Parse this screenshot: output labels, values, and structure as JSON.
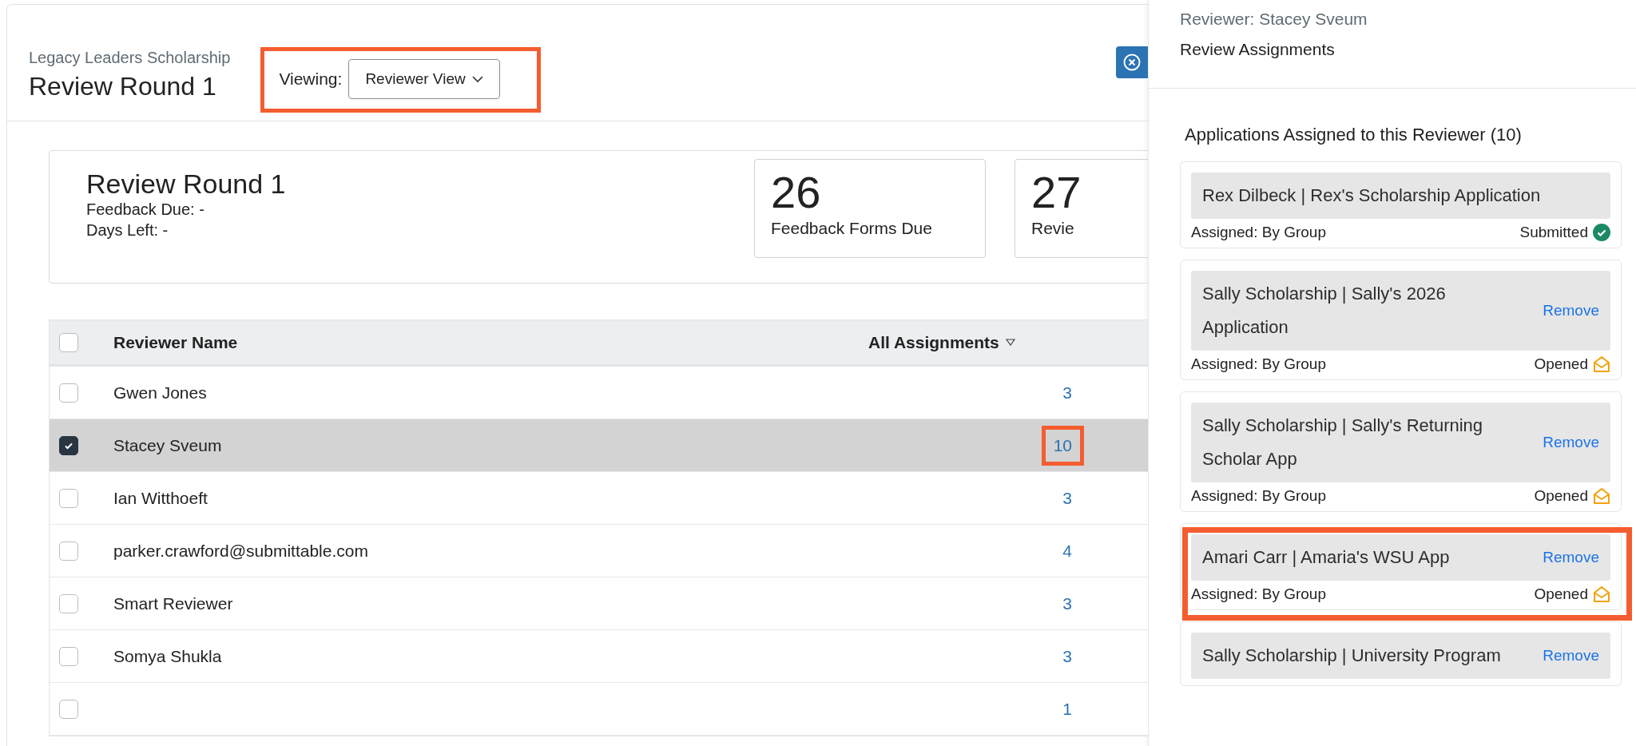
{
  "header": {
    "program": "Legacy Leaders Scholarship",
    "title": "Review Round 1",
    "viewing_label": "Viewing:",
    "view_select": "Reviewer View",
    "highlighted": true
  },
  "summary": {
    "title": "Review Round 1",
    "lines": [
      "Feedback Due: -",
      "Days Left: -"
    ],
    "stats": [
      {
        "value": "26",
        "label": "Feedback Forms Due"
      },
      {
        "value": "27",
        "label": "Revie"
      }
    ]
  },
  "table": {
    "columns": [
      "Reviewer Name",
      "All Assignments"
    ],
    "header_checked": false,
    "rows": [
      {
        "name": "Gwen Jones",
        "count": "3",
        "selected": false,
        "highlighted": false
      },
      {
        "name": "Stacey Sveum",
        "count": "10",
        "selected": true,
        "highlighted": true
      },
      {
        "name": "Ian Witthoeft",
        "count": "3",
        "selected": false,
        "highlighted": false
      },
      {
        "name": "parker.crawford@submittable.com",
        "count": "4",
        "selected": false,
        "highlighted": false
      },
      {
        "name": "Smart Reviewer",
        "count": "3",
        "selected": false,
        "highlighted": false
      },
      {
        "name": "Somya Shukla",
        "count": "3",
        "selected": false,
        "highlighted": false
      },
      {
        "count": "1",
        "selected": false,
        "highlighted": false
      }
    ]
  },
  "panel": {
    "reviewer": "Reviewer: Stacey Sveum",
    "title": "Review Assignments",
    "heading": "Applications Assigned to this Reviewer (10)",
    "assignments": [
      {
        "title": "Rex Dilbeck | Rex's Scholarship Application",
        "assigned": "Assigned: By Group",
        "status": "Submitted",
        "kind": "submitted",
        "highlighted": false
      },
      {
        "title": "Sally Scholarship | Sally's 2026 Application",
        "action": "Remove",
        "assigned": "Assigned: By Group",
        "status": "Opened",
        "kind": "opened",
        "highlighted": false
      },
      {
        "title": "Sally Scholarship | Sally's Returning Scholar App",
        "action": "Remove",
        "assigned": "Assigned: By Group",
        "status": "Opened",
        "kind": "opened",
        "highlighted": false
      },
      {
        "title": "Amari Carr | Amaria's WSU App",
        "action": "Remove",
        "assigned": "Assigned: By Group",
        "status": "Opened",
        "kind": "opened",
        "highlighted": true
      },
      {
        "title": "Sally Scholarship | University Program",
        "action": "Remove",
        "highlighted": false
      }
    ]
  }
}
